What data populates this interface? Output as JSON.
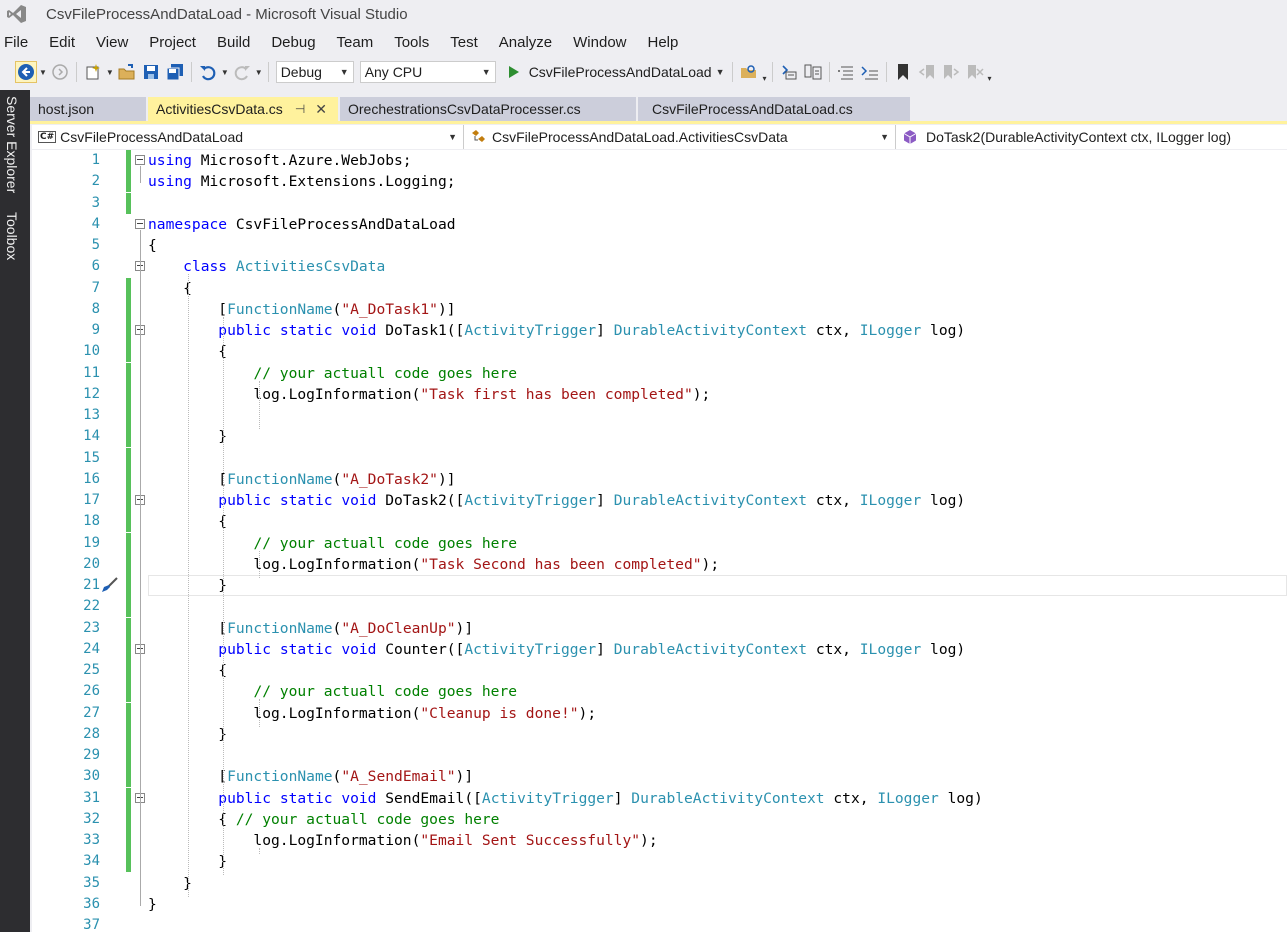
{
  "window": {
    "title": "CsvFileProcessAndDataLoad - Microsoft Visual Studio"
  },
  "menu": [
    "File",
    "Edit",
    "View",
    "Project",
    "Build",
    "Debug",
    "Team",
    "Tools",
    "Test",
    "Analyze",
    "Window",
    "Help"
  ],
  "toolbar": {
    "config": "Debug",
    "platform": "Any CPU",
    "run_target": "CsvFileProcessAndDataLoad"
  },
  "side_rail": [
    "Server Explorer",
    "Toolbox"
  ],
  "tabs": [
    {
      "label": "host.json",
      "active": false
    },
    {
      "label": "ActivitiesCsvData.cs",
      "active": true
    },
    {
      "label": "OrechestrationsCsvDataProcesser.cs",
      "active": false
    },
    {
      "label": "CsvFileProcessAndDataLoad.cs",
      "active": false
    }
  ],
  "nav": {
    "project": "CsvFileProcessAndDataLoad",
    "type": "CsvFileProcessAndDataLoad.ActivitiesCsvData",
    "member": "DoTask2(DurableActivityContext ctx, ILogger log)"
  },
  "code_lines": [
    "using Microsoft.Azure.WebJobs;",
    "using Microsoft.Extensions.Logging;",
    "",
    "namespace CsvFileProcessAndDataLoad",
    "{",
    "    class ActivitiesCsvData",
    "    {",
    "        [FunctionName(\"A_DoTask1\")]",
    "        public static void DoTask1([ActivityTrigger] DurableActivityContext ctx, ILogger log)",
    "        {",
    "            // your actuall code goes here",
    "            log.LogInformation(\"Task first has been completed\");",
    "",
    "        }",
    "",
    "        [FunctionName(\"A_DoTask2\")]",
    "        public static void DoTask2([ActivityTrigger] DurableActivityContext ctx, ILogger log)",
    "        {",
    "            // your actuall code goes here",
    "            log.LogInformation(\"Task Second has been completed\");",
    "        }",
    "",
    "        [FunctionName(\"A_DoCleanUp\")]",
    "        public static void Counter([ActivityTrigger] DurableActivityContext ctx, ILogger log)",
    "        {",
    "            // your actuall code goes here",
    "            log.LogInformation(\"Cleanup is done!\");",
    "        }",
    "",
    "        [FunctionName(\"A_SendEmail\")]",
    "        public static void SendEmail([ActivityTrigger] DurableActivityContext ctx, ILogger log)",
    "        { // your actuall code goes here",
    "            log.LogInformation(\"Email Sent Successfully\");",
    "        }",
    "    }",
    "}",
    ""
  ],
  "colors": {
    "keyword": "#0000ff",
    "type": "#2b91af",
    "string": "#a31515",
    "comment": "#008000",
    "change_bar": "#57c15b",
    "active_tab": "#fff29d"
  }
}
